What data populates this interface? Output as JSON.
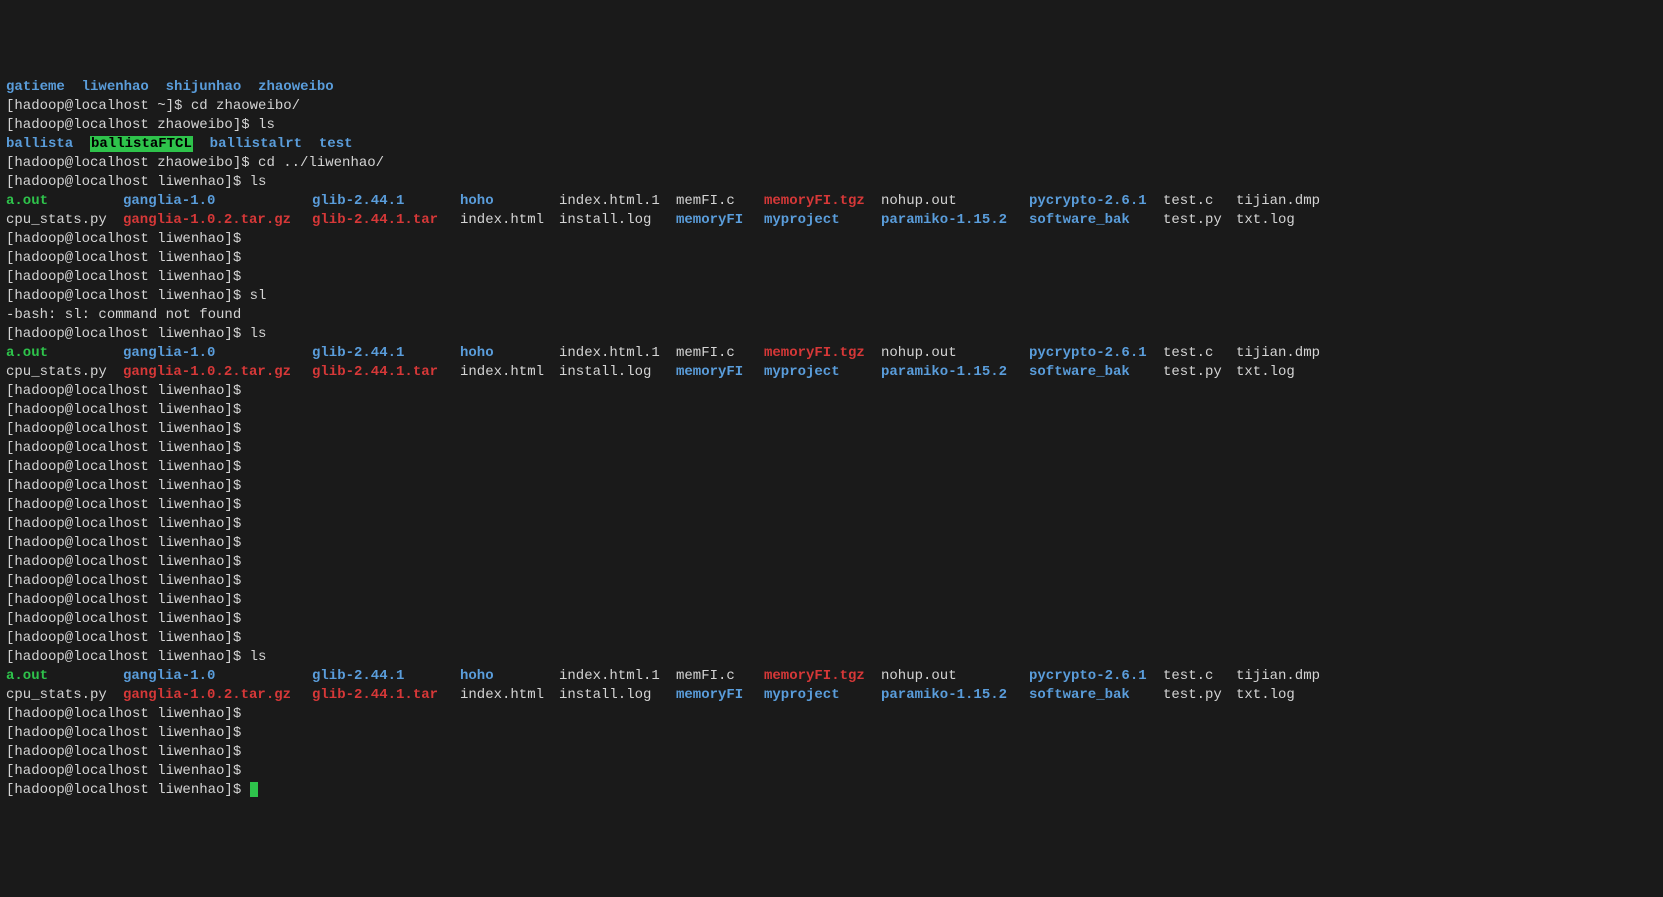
{
  "top_dirs": [
    "gatieme",
    "liwenhao",
    "shijunhao",
    "zhaoweibo"
  ],
  "prompt_home": "[hadoop@localhost ~]$ ",
  "prompt_zhaoweibo": "[hadoop@localhost zhaoweibo]$ ",
  "prompt_liwenhao": "[hadoop@localhost liwenhao]$ ",
  "cmd_cd_zhaoweibo": "cd zhaoweibo/",
  "cmd_ls": "ls",
  "cmd_cd_liwenhao": "cd ../liwenhao/",
  "cmd_sl": "sl",
  "err_sl": "-bash: sl: command not found",
  "zhaoweibo_ls": {
    "ballista": "ballista",
    "ballistaFTCL": "ballistaFTCL",
    "ballistalrt": "ballistalrt",
    "test": "test"
  },
  "ls_row1": {
    "c1": "a.out",
    "c2": "ganglia-1.0",
    "c3": "glib-2.44.1",
    "c4": "hoho",
    "c5": "index.html.1",
    "c6": "memFI.c",
    "c7": "memoryFI.tgz",
    "c8": "nohup.out",
    "c9": "pycrypto-2.6.1",
    "c10": "test.c",
    "c11": "tijian.dmp"
  },
  "ls_row2": {
    "c1": "cpu_stats.py",
    "c2": "ganglia-1.0.2.tar.gz",
    "c3": "glib-2.44.1.tar",
    "c4": "index.html",
    "c5": "install.log",
    "c6": "memoryFI",
    "c7": "myproject",
    "c8": "paramiko-1.15.2",
    "c9": "software_bak",
    "c10": "test.py",
    "c11": "txt.log"
  }
}
